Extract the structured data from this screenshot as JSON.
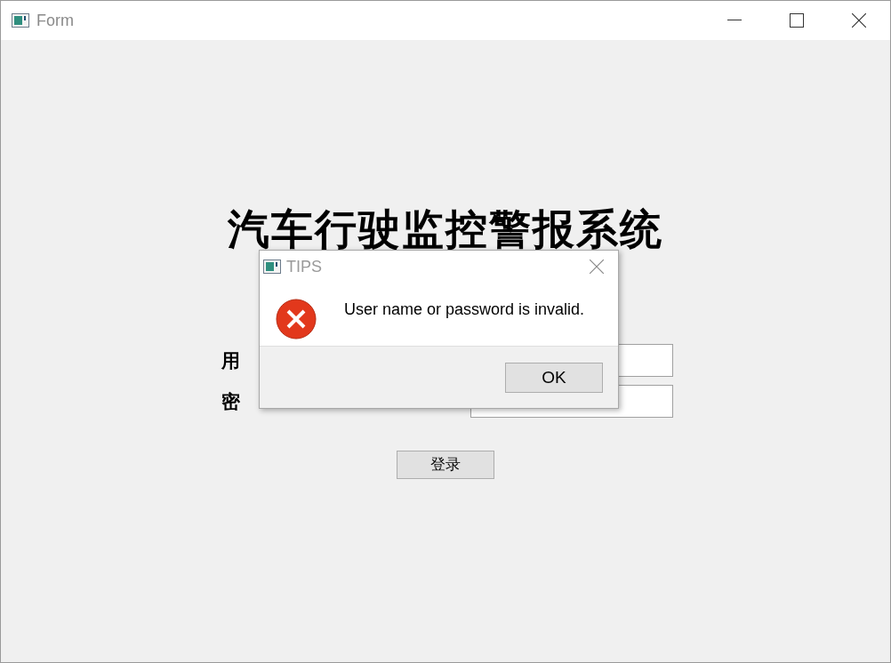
{
  "window": {
    "title": "Form"
  },
  "heading": "汽车行驶监控警报系统",
  "fields": [
    {
      "label": "用"
    },
    {
      "label": "密"
    }
  ],
  "login_button": "登录",
  "dialog": {
    "title": "TIPS",
    "message": "User name or password is invalid.",
    "button": "OK"
  }
}
